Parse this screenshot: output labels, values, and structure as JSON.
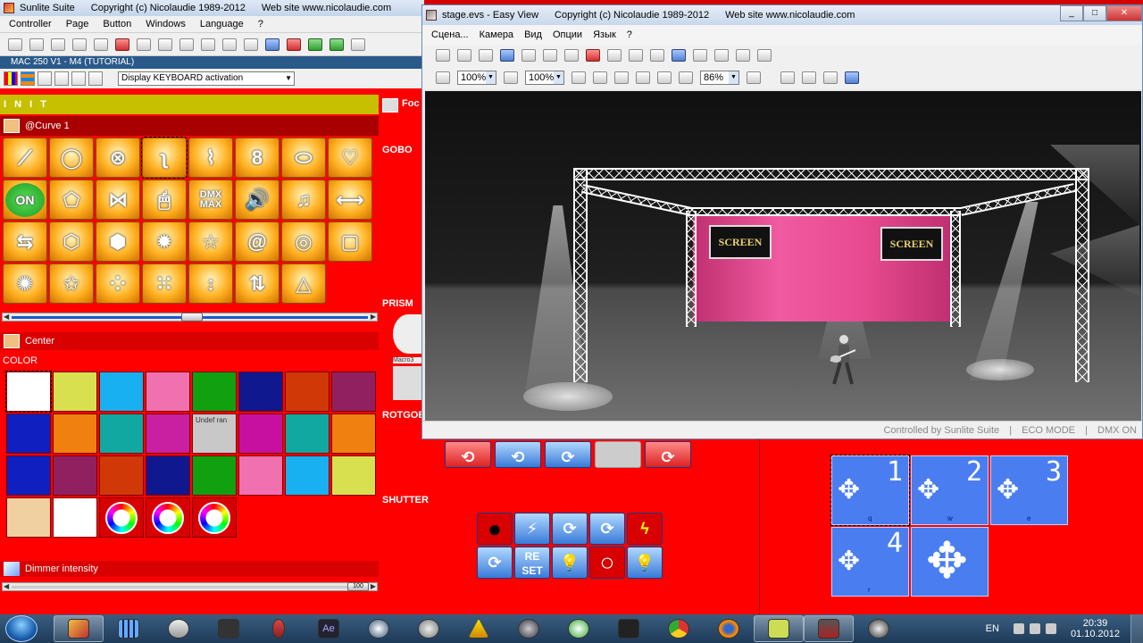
{
  "main_window": {
    "title_parts": [
      "Sunlite Suite",
      "Copyright (c) Nicolaudie 1989-2012",
      "Web site www.nicolaudie.com"
    ],
    "menu": [
      "Controller",
      "Page",
      "Button",
      "Windows",
      "Language",
      "?"
    ],
    "fixture": "MAC 250 V1 - M4 (TUTORIAL)",
    "mode_select": "Display KEYBOARD activation"
  },
  "init_label": "I N I T",
  "curve_section": {
    "title": "@Curve 1",
    "buttons": [
      {
        "glyph": "⟋",
        "name": "curve-line-icon"
      },
      {
        "glyph": "◯",
        "name": "curve-circle-icon"
      },
      {
        "glyph": "⊗",
        "name": "curve-rings-icon"
      },
      {
        "glyph": "ʅ",
        "name": "curve-s-icon"
      },
      {
        "glyph": "⌇",
        "name": "curve-zigzag-icon"
      },
      {
        "glyph": "8",
        "name": "curve-eight-icon"
      },
      {
        "glyph": "⬭",
        "name": "curve-ellipse-icon"
      },
      {
        "glyph": "♡",
        "name": "curve-heart-icon"
      },
      {
        "glyph": "ON",
        "name": "curve-on-icon"
      },
      {
        "glyph": "⬠",
        "name": "curve-polygon-icon"
      },
      {
        "glyph": "⋈",
        "name": "curve-bowtie-icon"
      },
      {
        "glyph": "🖱",
        "name": "curve-mouse-icon"
      },
      {
        "glyph": "DMX MAX",
        "name": "curve-dmx-max-icon"
      },
      {
        "glyph": "🔊",
        "name": "curve-speaker-icon"
      },
      {
        "glyph": "♫",
        "name": "curve-music-icon"
      },
      {
        "glyph": "⟷",
        "name": "curve-horizontal-icon"
      },
      {
        "glyph": "⇆",
        "name": "curve-swap-icon"
      },
      {
        "glyph": "⬡",
        "name": "curve-hexagon-icon"
      },
      {
        "glyph": "⬢",
        "name": "curve-blob-icon"
      },
      {
        "glyph": "✹",
        "name": "curve-burst-icon"
      },
      {
        "glyph": "☆",
        "name": "curve-star-icon"
      },
      {
        "glyph": "@",
        "name": "curve-spiral-icon"
      },
      {
        "glyph": "◎",
        "name": "curve-spiral2-icon"
      },
      {
        "glyph": "▢",
        "name": "curve-square-icon"
      },
      {
        "glyph": "✺",
        "name": "curve-starburst-icon"
      },
      {
        "glyph": "✩",
        "name": "curve-pentagram-icon"
      },
      {
        "glyph": "⁘",
        "name": "curve-random-icon"
      },
      {
        "glyph": "⁙",
        "name": "curve-random2-icon"
      },
      {
        "glyph": "↕",
        "name": "curve-vertical-icon"
      },
      {
        "glyph": "⇅",
        "name": "curve-updown-icon"
      },
      {
        "glyph": "△",
        "name": "curve-triangle-icon"
      }
    ]
  },
  "center_label": "Center",
  "color_label": "COLOR",
  "colors": [
    {
      "hex": "#ffffff"
    },
    {
      "hex": "#d8e050"
    },
    {
      "hex": "#18b0f0"
    },
    {
      "hex": "#f070b0"
    },
    {
      "hex": "#10a010"
    },
    {
      "hex": "#101890"
    },
    {
      "hex": "#d03808"
    },
    {
      "hex": "#902060"
    },
    {
      "hex": "#1020c0"
    },
    {
      "hex": "#f08010"
    },
    {
      "hex": "#10a8a0"
    },
    {
      "hex": "#c820a0"
    },
    {
      "hex": "#c8c8c8",
      "text": "Undef ran"
    },
    {
      "hex": "#c810a0"
    },
    {
      "hex": "#10a8a0"
    },
    {
      "hex": "#f08010"
    },
    {
      "hex": "#1020c0"
    },
    {
      "hex": "#902060"
    },
    {
      "hex": "#d03808"
    },
    {
      "hex": "#101890"
    },
    {
      "hex": "#10a010"
    },
    {
      "hex": "#f070b0"
    },
    {
      "hex": "#18b0f0"
    },
    {
      "hex": "#d8e050"
    },
    {
      "hex": "#f0d0a0"
    },
    {
      "hex": "#ffffff"
    }
  ],
  "dimmer_label": "Dimmer intensity",
  "dimmer_value": "100",
  "side_labels": {
    "gobo": "GOBO",
    "prism": "PRISM",
    "rotgobo": "ROTGOB",
    "shutter": "SHUTTER",
    "focus": "Foc",
    "macro": "Macro3"
  },
  "shutter_buttons": [
    "●",
    "⚡",
    "⟳",
    "⟳",
    "ϟ",
    "⟳",
    "RE SET",
    "💡",
    "○",
    "💡"
  ],
  "position_buttons": [
    {
      "num": "1",
      "key": "q"
    },
    {
      "num": "2",
      "key": "w"
    },
    {
      "num": "3",
      "key": "e"
    },
    {
      "num": "4",
      "key": "r"
    },
    {
      "num": "",
      "key": ""
    }
  ],
  "easy_view": {
    "title_parts": [
      "stage.evs - Easy View",
      "Copyright (c) Nicolaudie 1989-2012",
      "Web site www.nicolaudie.com"
    ],
    "menu": [
      "Сцена...",
      "Камера",
      "Вид",
      "Опции",
      "Язык",
      "?"
    ],
    "zoom1": "100%",
    "zoom2": "100%",
    "zoom3": "86%",
    "screen_left": "SCREEN",
    "screen_right": "SCREEN",
    "status": [
      "Controlled by Sunlite Suite",
      "|",
      "ECO MODE",
      "|",
      "DMX ON"
    ]
  },
  "taskbar": {
    "lang": "EN",
    "time": "20:39",
    "date": "01.10.2012"
  }
}
